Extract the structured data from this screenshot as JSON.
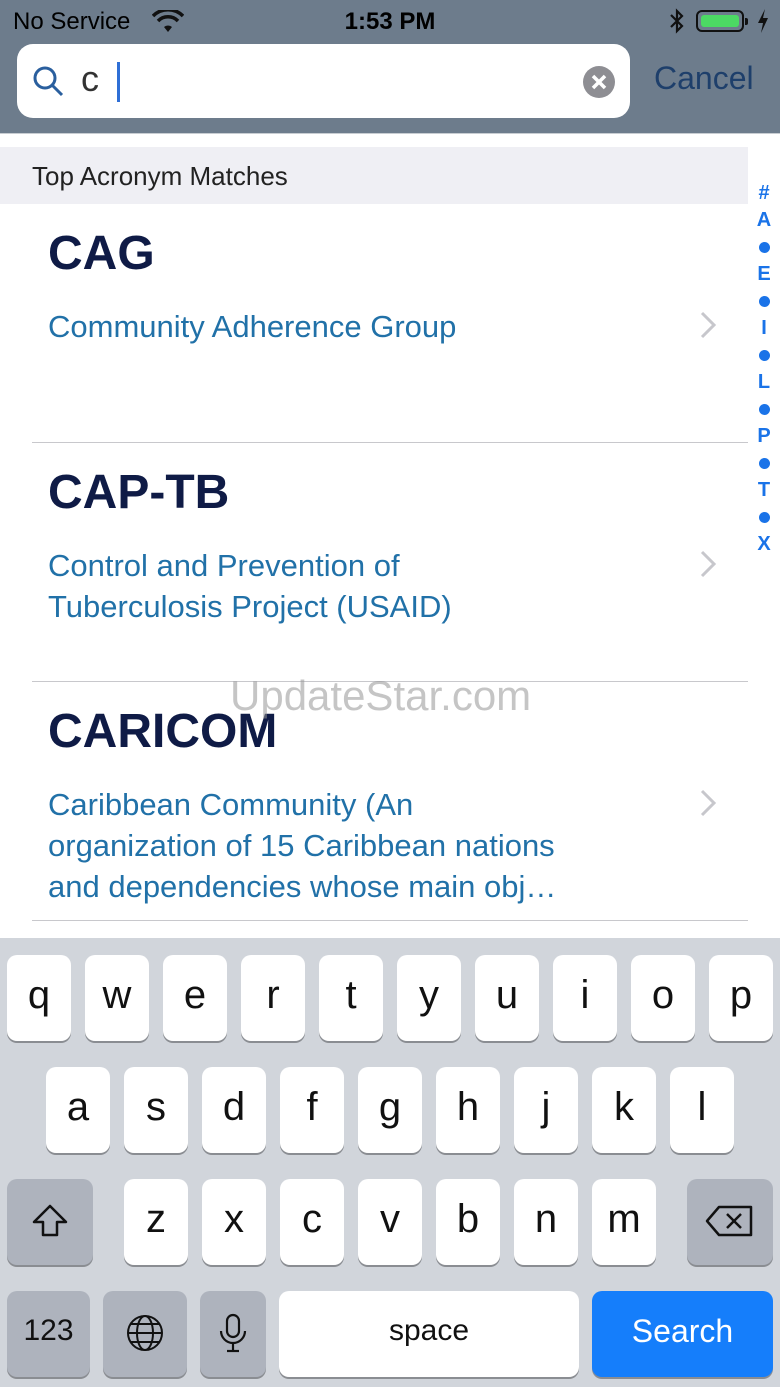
{
  "status": {
    "carrier": "No Service",
    "time": "1:53 PM"
  },
  "search": {
    "query": "c",
    "cancel_label": "Cancel"
  },
  "section_title": "Top Acronym Matches",
  "results": [
    {
      "acronym": "CAG",
      "definition_lines": [
        "Community Adherence Group"
      ]
    },
    {
      "acronym": "CAP-TB",
      "definition_lines": [
        "Control and Prevention of",
        "Tuberculosis Project (USAID)"
      ]
    },
    {
      "acronym": "CARICOM",
      "definition_lines": [
        "Caribbean Community (An",
        "organization of 15 Caribbean nations",
        "and dependencies whose main obj…"
      ]
    }
  ],
  "index": [
    "#",
    "A",
    "E",
    "I",
    "L",
    "P",
    "T",
    "X"
  ],
  "watermark": "UpdateStar.com",
  "keyboard": {
    "row1": [
      "q",
      "w",
      "e",
      "r",
      "t",
      "y",
      "u",
      "i",
      "o",
      "p"
    ],
    "row2": [
      "a",
      "s",
      "d",
      "f",
      "g",
      "h",
      "j",
      "k",
      "l"
    ],
    "row3": [
      "z",
      "x",
      "c",
      "v",
      "b",
      "n",
      "m"
    ],
    "numbers_label": "123",
    "space_label": "space",
    "search_label": "Search"
  },
  "colors": {
    "header": "#6d7c8c",
    "acronym": "#0f1b46",
    "definition": "#2171a8",
    "index": "#1a73e8",
    "search_key": "#157efb"
  }
}
